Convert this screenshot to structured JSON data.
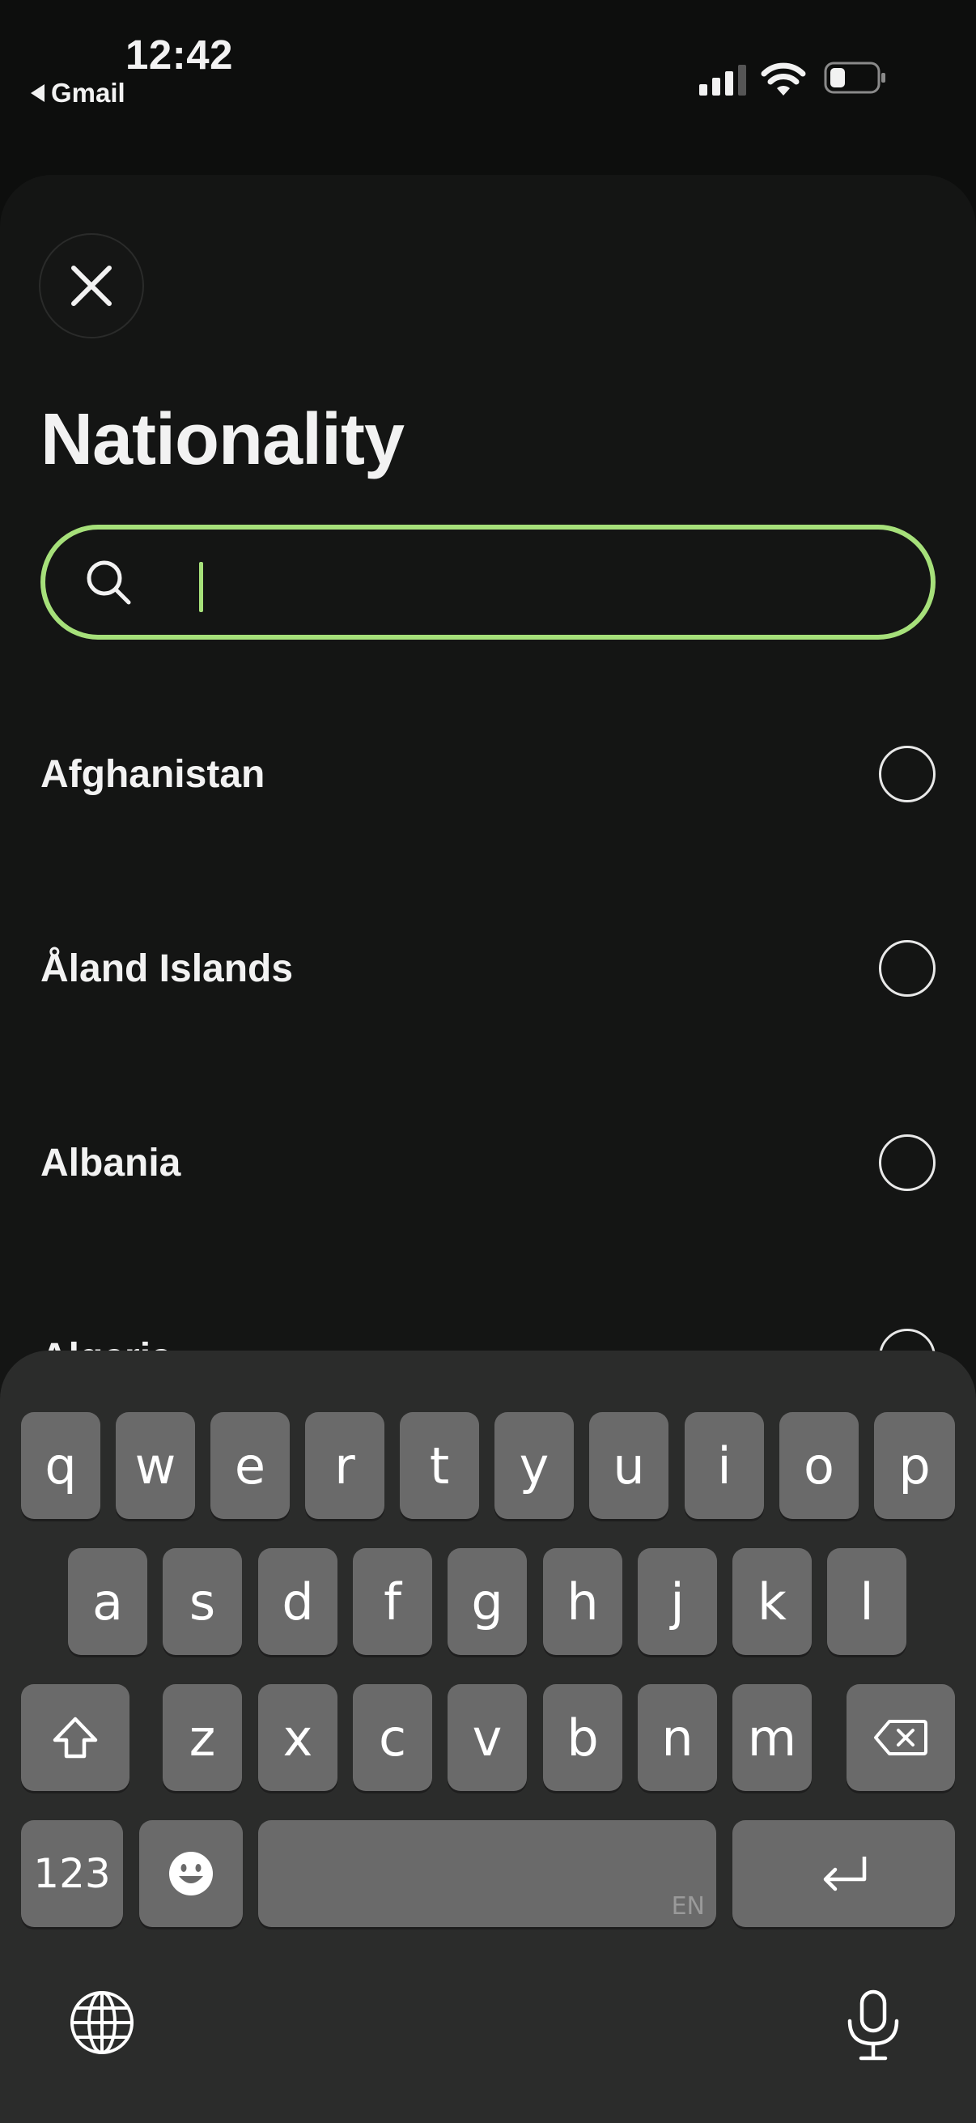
{
  "status_bar": {
    "time": "12:42",
    "back_app": "Gmail",
    "icons": [
      "cellular-signal-icon",
      "wifi-icon",
      "battery-icon"
    ]
  },
  "sheet": {
    "close_icon": "close-icon",
    "title": "Nationality",
    "search": {
      "placeholder": "",
      "value": "",
      "icon": "search-icon",
      "accent": "#a6e07a"
    },
    "countries": [
      {
        "name": "Afghanistan",
        "selected": false
      },
      {
        "name": "Åland Islands",
        "selected": false
      },
      {
        "name": "Albania",
        "selected": false
      },
      {
        "name": "Algeria",
        "selected": false
      }
    ]
  },
  "keyboard": {
    "row1": [
      "q",
      "w",
      "e",
      "r",
      "t",
      "y",
      "u",
      "i",
      "o",
      "p"
    ],
    "row2": [
      "a",
      "s",
      "d",
      "f",
      "g",
      "h",
      "j",
      "k",
      "l"
    ],
    "row3": [
      "z",
      "x",
      "c",
      "v",
      "b",
      "n",
      "m"
    ],
    "numbers_label": "123",
    "space_lang": "EN",
    "icons": [
      "shift-icon",
      "delete-icon",
      "emoji-icon",
      "return-icon",
      "globe-icon",
      "microphone-icon"
    ]
  },
  "colors": {
    "background": "#0d0e0d",
    "sheet": "#141514",
    "accent": "#a6e07a",
    "key": "#6a6a6a"
  }
}
